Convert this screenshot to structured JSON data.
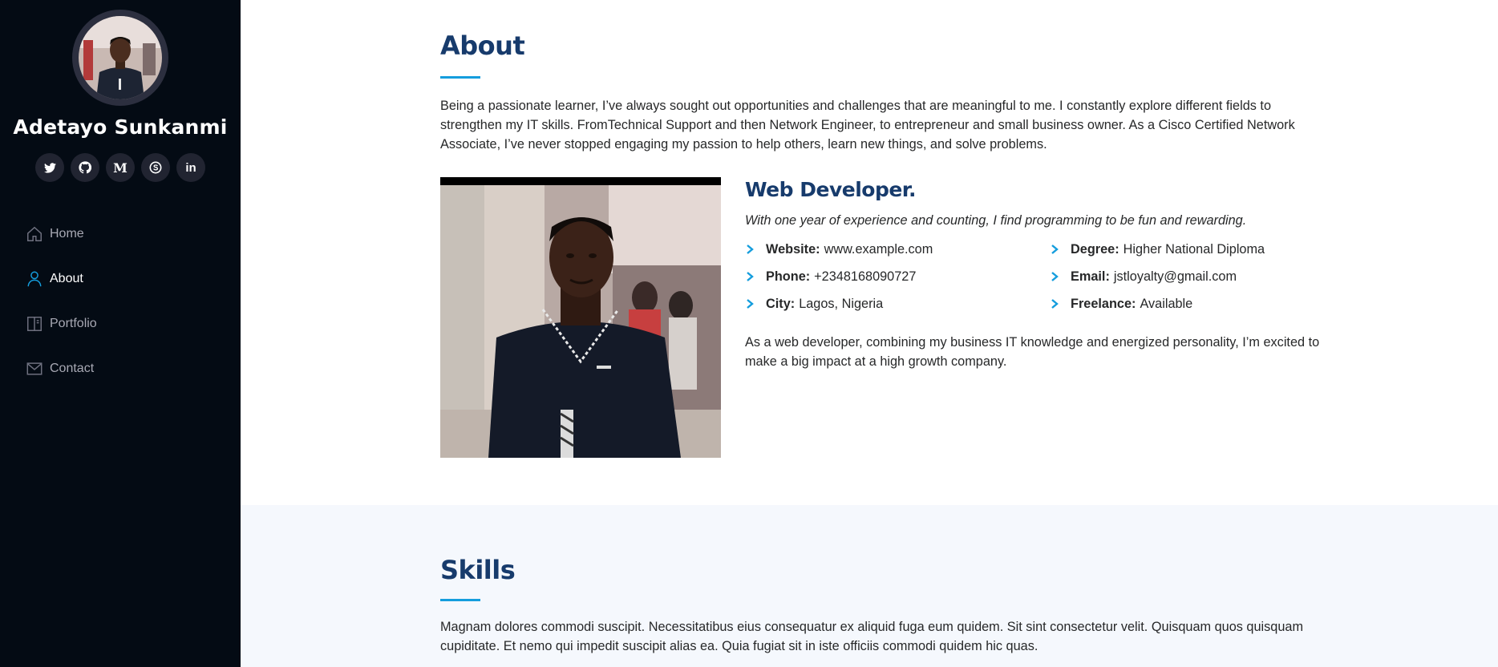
{
  "sidebar": {
    "profile_name": "Adetayo Sunkanmi",
    "social_links": [
      {
        "icon": "twitter-icon"
      },
      {
        "icon": "github-icon"
      },
      {
        "icon": "medium-icon",
        "glyph": "M"
      },
      {
        "icon": "skype-icon"
      },
      {
        "icon": "linkedin-icon",
        "glyph": "in"
      }
    ],
    "nav": {
      "home": {
        "label": "Home",
        "icon": "home-icon"
      },
      "about": {
        "label": "About",
        "icon": "person-icon"
      },
      "portfolio": {
        "label": "Portfolio",
        "icon": "book-icon"
      },
      "contact": {
        "label": "Contact",
        "icon": "envelope-icon"
      }
    },
    "active_item": "About"
  },
  "about": {
    "title": "About",
    "intro": "Being a passionate learner, I’ve always sought out opportunities and challenges that are meaningful to me. I constantly explore different fields to strengthen my IT skills. FromTechnical Support and then Network Engineer, to entrepreneur and small business owner. As a Cisco Certified Network Associate, I’ve never stopped engaging my passion to help others, learn new things, and solve problems.",
    "role_title": "Web Developer.",
    "tagline": "With one year of experience and counting, I find programming to be fun and rewarding.",
    "details": {
      "website": {
        "label": "Website:",
        "value": "www.example.com"
      },
      "degree": {
        "label": "Degree:",
        "value": "Higher National Diploma"
      },
      "phone": {
        "label": "Phone:",
        "value": "+2348168090727"
      },
      "email": {
        "label": "Email:",
        "value": "jstloyalty@gmail.com"
      },
      "city": {
        "label": "City:",
        "value": "Lagos, Nigeria"
      },
      "freelance": {
        "label": "Freelance:",
        "value": "Available"
      }
    },
    "summary": "As a web developer, combining my business IT knowledge and energized personality, I’m excited to make a big impact at a high growth company."
  },
  "skills": {
    "title": "Skills",
    "text": "Magnam dolores commodi suscipit. Necessitatibus eius consequatur ex aliquid fuga eum quidem. Sit sint consectetur velit. Quisquam quos quisquam cupiditate. Et nemo qui impedit suscipit alias ea. Quia fugiat sit in iste officiis commodi quidem hic quas."
  },
  "colors": {
    "sidebar_bg": "#040b14",
    "accent": "#149ddd",
    "heading": "#173b6c",
    "nav_text": "#a8a9b4",
    "skills_bg": "#f5f8fd"
  }
}
